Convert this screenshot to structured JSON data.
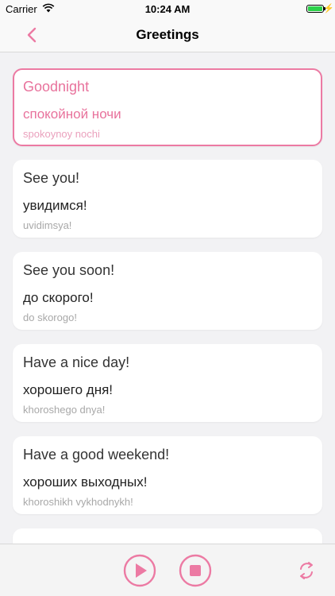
{
  "status": {
    "carrier": "Carrier",
    "time": "10:24 AM"
  },
  "nav": {
    "title": "Greetings",
    "back_icon": "chevron-left-icon"
  },
  "accent_color": "#ec7aa3",
  "phrases": [
    {
      "english": "Goodnight",
      "russian": "спокойной ночи",
      "translit": "spokoynoy nochi",
      "selected": true
    },
    {
      "english": "See you!",
      "russian": "увидимся!",
      "translit": "uvidimsya!"
    },
    {
      "english": "See you soon!",
      "russian": "до скорого!",
      "translit": "do skorogo!"
    },
    {
      "english": "Have a nice day!",
      "russian": "хорошего дня!",
      "translit": "khoroshego dnya!"
    },
    {
      "english": "Have a good weekend!",
      "russian": "хороших выходных!",
      "translit": "khoroshikh vykhodnykh!"
    },
    {
      "english": "",
      "russian": "",
      "translit": ""
    }
  ],
  "toolbar": {
    "play_icon": "play-icon",
    "stop_icon": "stop-icon",
    "repeat_icon": "repeat-icon"
  }
}
